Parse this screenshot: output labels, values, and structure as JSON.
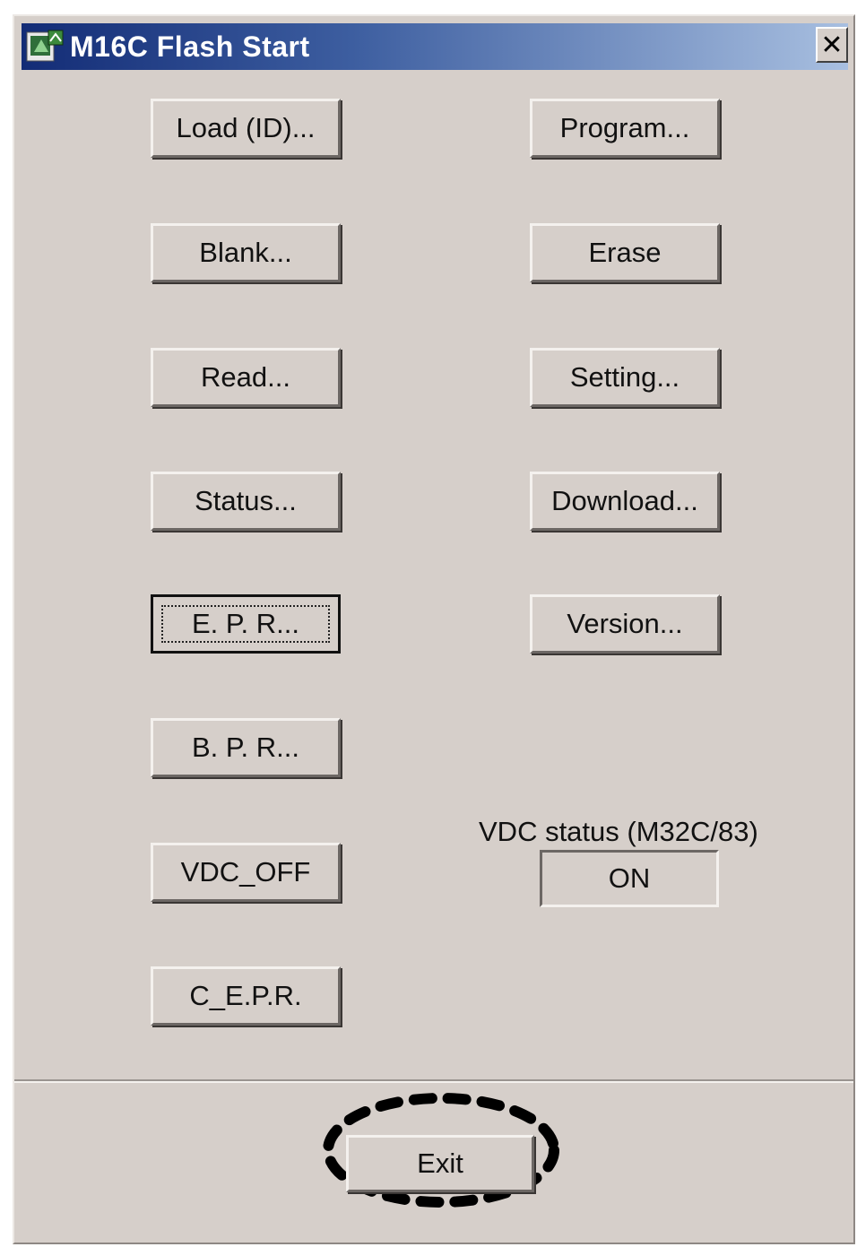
{
  "window": {
    "title": "M16C Flash Start",
    "close_label": "✕"
  },
  "buttons_left": [
    {
      "label": "Load (ID)...",
      "name": "load-id-button"
    },
    {
      "label": "Blank...",
      "name": "blank-button"
    },
    {
      "label": "Read...",
      "name": "read-button"
    },
    {
      "label": "Status...",
      "name": "status-button"
    },
    {
      "label": "E. P. R...",
      "name": "epr-button"
    },
    {
      "label": "B. P. R...",
      "name": "bpr-button"
    },
    {
      "label": "VDC_OFF",
      "name": "vdc-off-button"
    },
    {
      "label": "C_E.P.R.",
      "name": "c-epr-button"
    }
  ],
  "buttons_right": [
    {
      "label": "Program...",
      "name": "program-button"
    },
    {
      "label": "Erase",
      "name": "erase-button"
    },
    {
      "label": "Setting...",
      "name": "setting-button"
    },
    {
      "label": "Download...",
      "name": "download-button"
    },
    {
      "label": "Version...",
      "name": "version-button"
    }
  ],
  "vdc_status": {
    "label": "VDC status (M32C/83)",
    "value": "ON"
  },
  "exit": {
    "label": "Exit"
  },
  "colors": {
    "title_gradient_start": "#132c76",
    "title_gradient_end": "#a8bfe0",
    "face": "#d6cfca"
  }
}
